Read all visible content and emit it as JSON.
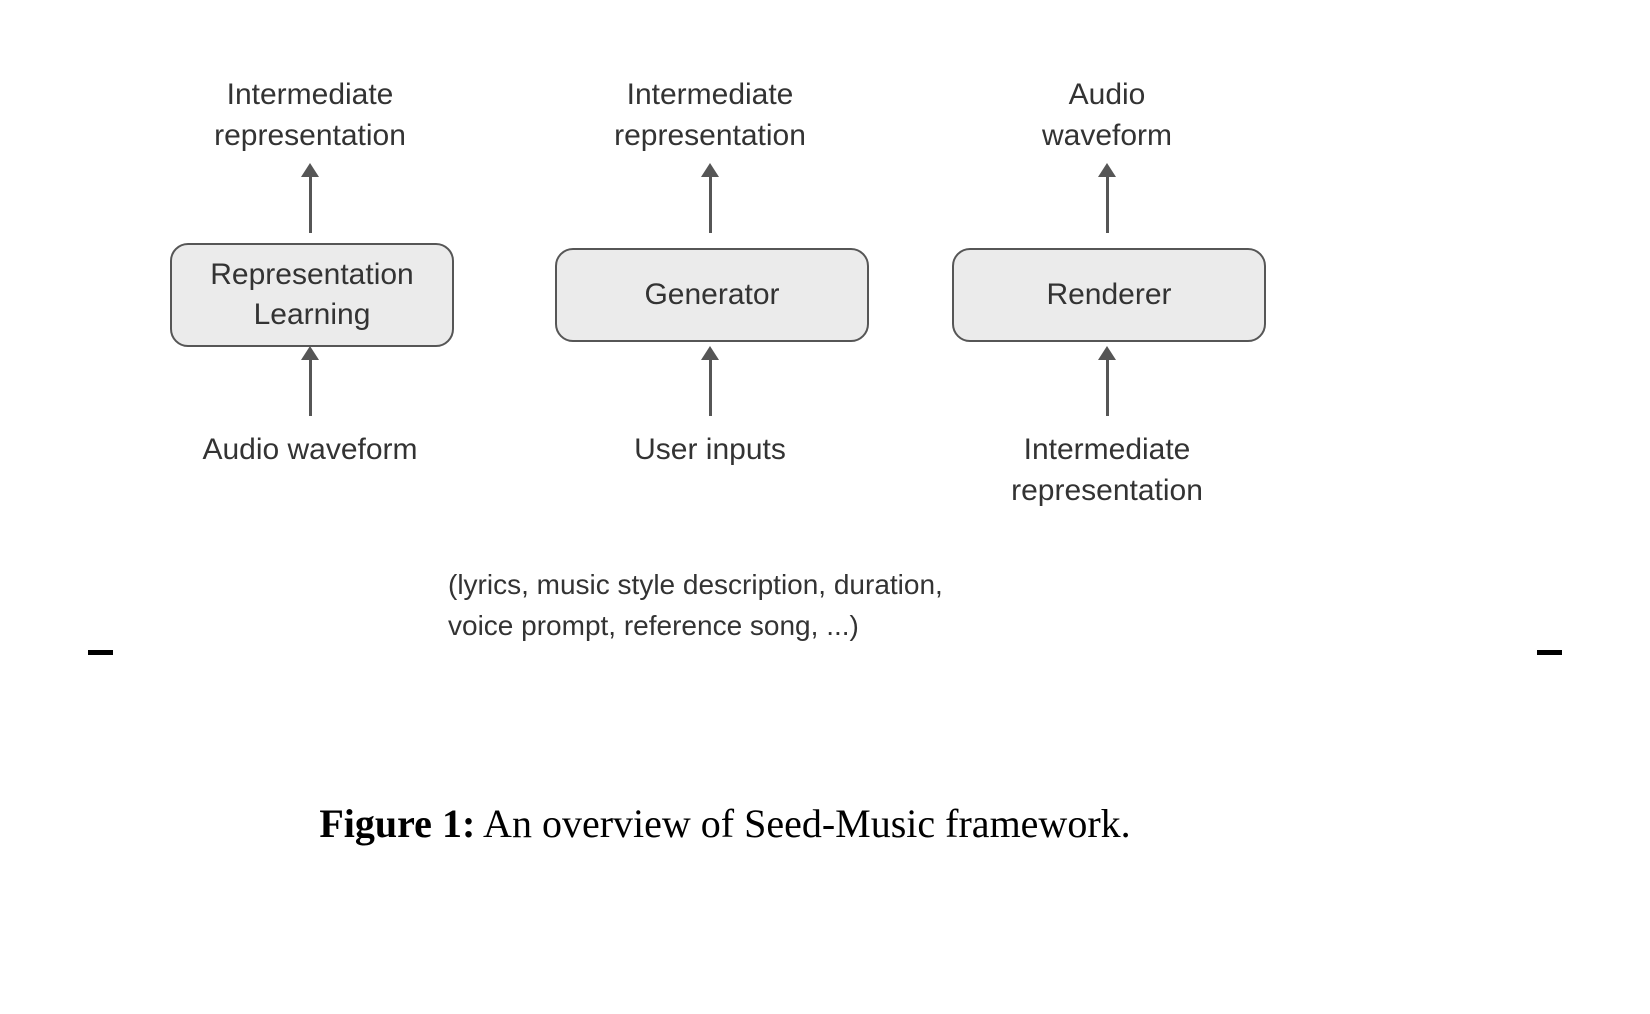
{
  "columns": [
    {
      "top": "Intermediate\nrepresentation",
      "box": "Representation\nLearning",
      "bottom": "Audio waveform"
    },
    {
      "top": "Intermediate\nrepresentation",
      "box": "Generator",
      "bottom": "User inputs"
    },
    {
      "top": "Audio\nwaveform",
      "box": "Renderer",
      "bottom": "Intermediate\nrepresentation"
    }
  ],
  "note": "(lyrics, music style description, duration,\nvoice prompt, reference song, ...)",
  "caption": {
    "label": "Figure 1:",
    "text": " An overview of Seed-Music framework."
  }
}
